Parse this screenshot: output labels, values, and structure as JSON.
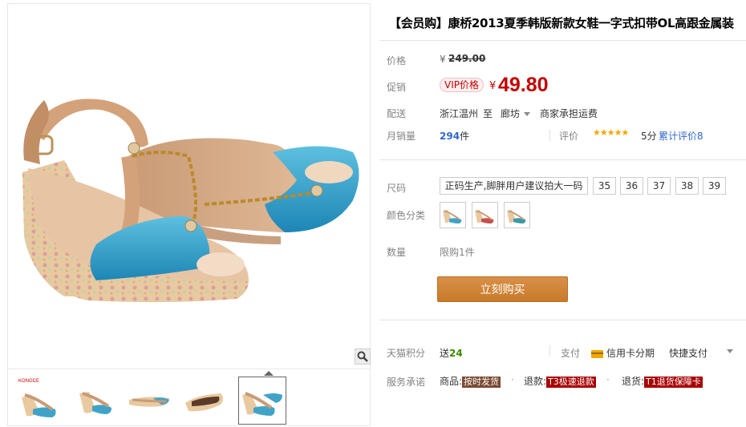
{
  "gallery": {
    "thumb_badge": "KONGCE",
    "thumbnails": [
      "thumb-1",
      "thumb-2",
      "thumb-3",
      "thumb-4",
      "thumb-5"
    ]
  },
  "product": {
    "title": "【会员购】康桥2013夏季韩版新款女鞋一字式扣带OL高跟金属装",
    "price_label": "价格",
    "price_yen": "¥",
    "price_original": "249.00",
    "promo_label": "促销",
    "vip_badge": "VIP价格",
    "promo_yen": "¥",
    "promo_price": "49.80",
    "shipping_label": "配送",
    "ship_from": "浙江温州",
    "ship_to_word": "至",
    "ship_dest": "廊坊",
    "ship_fee": "商家承担运费",
    "sales_label": "月销量",
    "sales_count": "294",
    "sales_unit": "件",
    "rating_label": "评价",
    "rating_stars": "★★★★★",
    "rating_score": "5分",
    "rating_total": "累计评价8",
    "size_label": "尺码",
    "sizes": [
      "正码生产,脚胖用户建议拍大一码",
      "35",
      "36",
      "37",
      "38",
      "39"
    ],
    "color_label": "颜色分类",
    "colors": [
      "#3fa3c8",
      "#c8504a",
      "#3a9aa8"
    ],
    "qty_label": "数量",
    "qty_limit": "限购1件",
    "buy_button": "立刻购买",
    "points_label": "天猫积分",
    "points_text": "送",
    "points_value": "24",
    "pay_label": "支付",
    "pay_credit": "信用卡分期",
    "pay_quick": "快捷支付",
    "service_label": "服务承诺",
    "svc_goods": "商品:",
    "svc_goods_tag": "按时发货",
    "svc_refund": "退款:",
    "svc_refund_tag": "T3极速退款",
    "svc_return": "退货:",
    "svc_return_tag": "T1退货保障卡",
    "dot": "·"
  }
}
